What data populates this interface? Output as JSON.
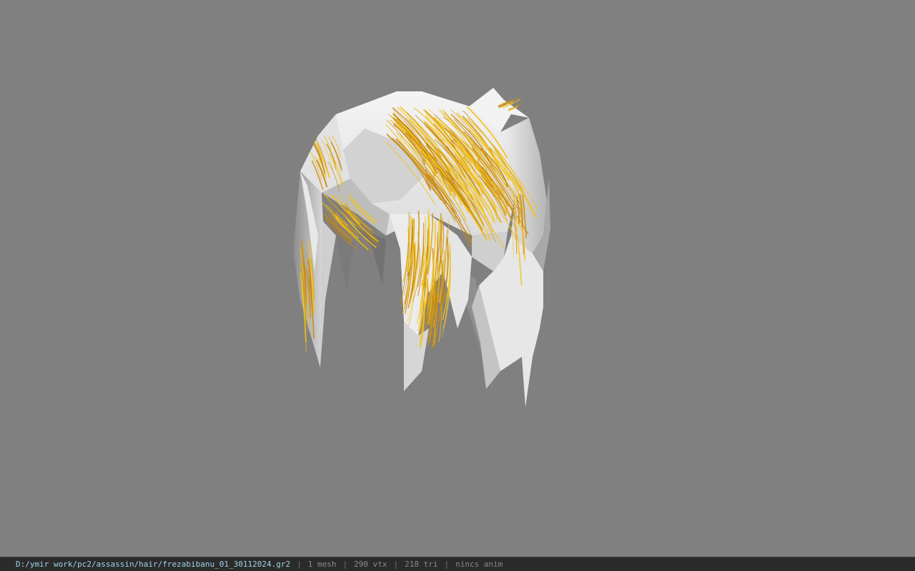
{
  "viewer": {
    "background_color": "#808080",
    "model": {
      "texture_colors": {
        "base": "#ededed",
        "strand_light": "#f2c21a",
        "strand_dark": "#c98a10"
      }
    }
  },
  "statusbar": {
    "file_path": "D:/ymir work/pc2/assassin/hair/frezabibanu_01_30112024.gr2",
    "separator": "|",
    "mesh_count": "1 mesh",
    "vertex_count": "290 vtx",
    "triangle_count": "218 tri",
    "animation_status": "nincs anim"
  }
}
